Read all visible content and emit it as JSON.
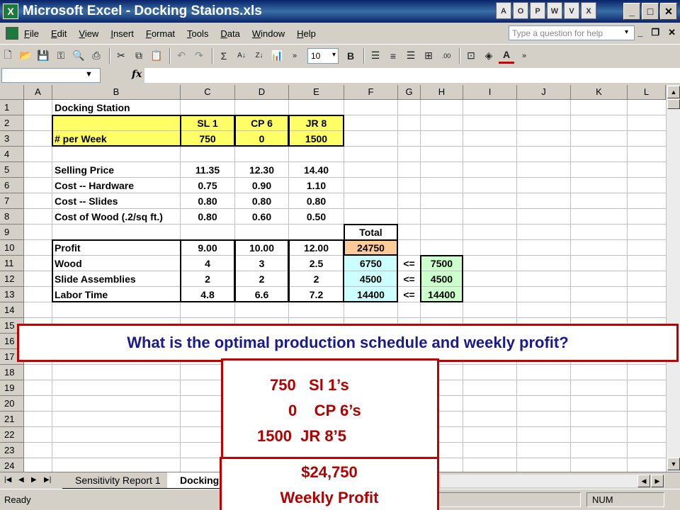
{
  "window": {
    "title": "Microsoft Excel - Docking Staions.xls",
    "controls": [
      "_",
      "□",
      "✕"
    ]
  },
  "menu": {
    "items": [
      "File",
      "Edit",
      "View",
      "Insert",
      "Format",
      "Tools",
      "Data",
      "Window",
      "Help"
    ],
    "ask_placeholder": "Type a question for help",
    "doc_controls": [
      "_",
      "❐",
      "✕"
    ]
  },
  "toolbar": {
    "font_size": "10",
    "buttons": [
      "new-icon",
      "open-icon",
      "save-icon",
      "permission-icon",
      "print-preview-icon",
      "print-icon",
      "cut-icon",
      "copy-icon",
      "paste-icon",
      "undo-icon",
      "redo-icon",
      "autosum-icon",
      "sort-asc-icon",
      "sort-desc-icon",
      "chart-icon",
      "bold-icon",
      "align-left-icon",
      "align-center-icon",
      "align-right-icon",
      "merge-center-icon",
      "decimal-icon",
      "borders-icon",
      "fill-color-icon",
      "font-color-icon"
    ]
  },
  "formula_bar": {
    "name_box": "",
    "fx": "fx",
    "formula": ""
  },
  "columns": [
    "A",
    "B",
    "C",
    "D",
    "E",
    "F",
    "G",
    "H",
    "I",
    "J",
    "K",
    "L"
  ],
  "rows": [
    "1",
    "2",
    "3",
    "4",
    "5",
    "6",
    "7",
    "8",
    "9",
    "10",
    "11",
    "12",
    "13",
    "14",
    "15",
    "16",
    "17",
    "18",
    "19",
    "20",
    "21",
    "22",
    "23",
    "24"
  ],
  "sheet": {
    "title": "Docking Station",
    "headers": [
      "SL 1",
      "CP 6",
      "JR 8"
    ],
    "per_week_label": "# per Week",
    "per_week": [
      "750",
      "0",
      "1500"
    ],
    "selling_price_label": "Selling Price",
    "selling_price": [
      "11.35",
      "12.30",
      "14.40"
    ],
    "cost_hw_label": "Cost -- Hardware",
    "cost_hw": [
      "0.75",
      "0.90",
      "1.10"
    ],
    "cost_slides_label": "Cost -- Slides",
    "cost_slides": [
      "0.80",
      "0.80",
      "0.80"
    ],
    "cost_wood_label": "Cost of Wood (.2/sq ft.)",
    "cost_wood": [
      "0.80",
      "0.60",
      "0.50"
    ],
    "total_label": "Total",
    "profit_label": "Profit",
    "profit": [
      "9.00",
      "10.00",
      "12.00"
    ],
    "profit_total": "24750",
    "wood_label": "Wood",
    "wood": [
      "4",
      "3",
      "2.5"
    ],
    "wood_total": "6750",
    "wood_limit": "7500",
    "slides_label": "Slide Assemblies",
    "slides": [
      "2",
      "2",
      "2"
    ],
    "slides_total": "4500",
    "slides_limit": "4500",
    "labor_label": "Labor Time",
    "labor": [
      "4.8",
      "6.6",
      "7.2"
    ],
    "labor_total": "14400",
    "labor_limit": "14400",
    "le": "<="
  },
  "tabs": [
    "Sensitivity Report 1",
    "Docking"
  ],
  "status": {
    "left": "Ready",
    "num": "NUM"
  },
  "overlay": {
    "question": "What is the optimal production schedule and weekly profit?",
    "answer_lines": [
      "750   Sl 1’s",
      "0    CP 6’s",
      "1500  JR 8’5"
    ],
    "profit_amount": "$24,750",
    "profit_label": "Weekly Profit"
  },
  "colors": {
    "title_bar": "#0a246a",
    "input_yellow": "#ffff66",
    "total_peach": "#ffcc99",
    "used_cyan": "#ccffff",
    "limit_green": "#ccffcc",
    "callout_border": "#c00000",
    "question_text": "#1a1a8c",
    "answer_text": "#b00000"
  }
}
